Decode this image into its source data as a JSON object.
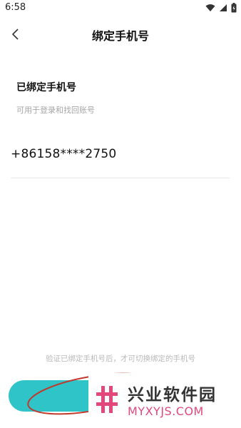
{
  "status_bar": {
    "time": "6:58",
    "icons": [
      "wifi-icon",
      "signal-icon",
      "battery-icon"
    ]
  },
  "nav": {
    "title": "绑定手机号",
    "back_icon": "chevron-left-icon"
  },
  "section": {
    "title": "已绑定手机号",
    "subtitle": "可用于登录和找回账号"
  },
  "phone": {
    "value": "+86158****2750"
  },
  "hint": {
    "text": "验证已绑定手机号后，才可切换绑定的手机号"
  },
  "button": {
    "color": "#2ec4c8"
  },
  "watermark": {
    "name": "兴业软件园",
    "domain": "MYXYJS.COM",
    "logo_color": "#e2487b"
  },
  "colors": {
    "accent": "#2ec4c8",
    "annotation_red": "#c0392b"
  }
}
